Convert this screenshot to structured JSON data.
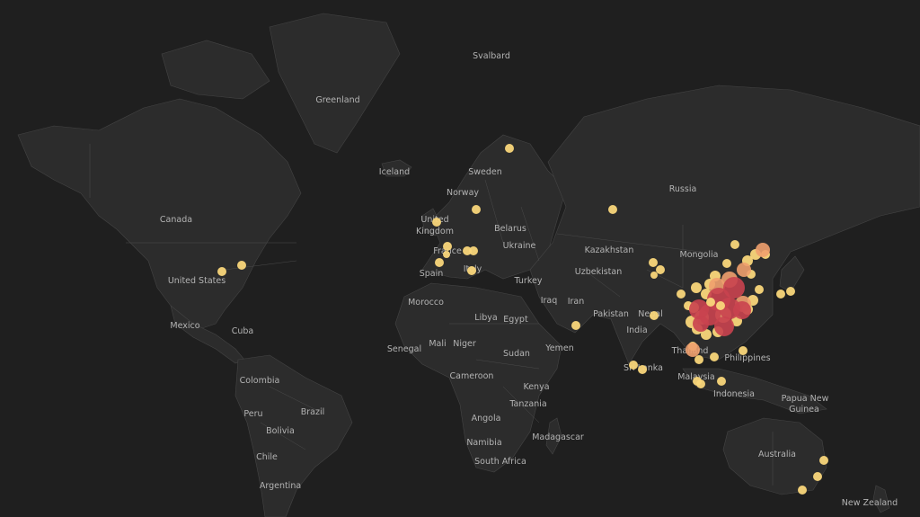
{
  "map": {
    "labels": {
      "svalbard": "Svalbard",
      "greenland": "Greenland",
      "iceland": "Iceland",
      "sweden": "Sweden",
      "norway": "Norway",
      "russia": "Russia",
      "canada": "Canada",
      "united_kingdom_1": "United",
      "united_kingdom_2": "Kingdom",
      "belarus": "Belarus",
      "ukraine": "Ukraine",
      "france": "France",
      "kazakhstan": "Kazakhstan",
      "mongolia": "Mongolia",
      "spain": "Spain",
      "italy": "Italy",
      "uzbekistan": "Uzbekistan",
      "united_states": "United States",
      "turkey": "Turkey",
      "morocco": "Morocco",
      "iran": "Iran",
      "iraq": "Iraq",
      "libya": "Libya",
      "egypt": "Egypt",
      "pakistan": "Pakistan",
      "nepal": "Nepal",
      "mexico": "Mexico",
      "cuba": "Cuba",
      "india": "India",
      "yemen": "Yemen",
      "senegal": "Senegal",
      "mali": "Mali",
      "niger": "Niger",
      "sudan": "Sudan",
      "thailand": "Thailand",
      "philippines": "Philippines",
      "cameroon": "Cameroon",
      "sri_lanka": "Sri Lanka",
      "malaysia": "Malaysia",
      "colombia": "Colombia",
      "kenya": "Kenya",
      "indonesia": "Indonesia",
      "papua_1": "Papua New",
      "papua_2": "Guinea",
      "peru": "Peru",
      "brazil": "Brazil",
      "tanzania": "Tanzania",
      "angola": "Angola",
      "bolivia": "Bolivia",
      "namibia": "Namibia",
      "madagascar": "Madagascar",
      "australia": "Australia",
      "chile": "Chile",
      "south_africa": "South Africa",
      "argentina": "Argentina",
      "new_zealand": "New Zealand"
    },
    "colors": {
      "background": "#1f1f1f",
      "land": "#2c2c2c",
      "small": "#f9d67a",
      "medium": "#f0a06e",
      "large": "#c9424f"
    }
  }
}
